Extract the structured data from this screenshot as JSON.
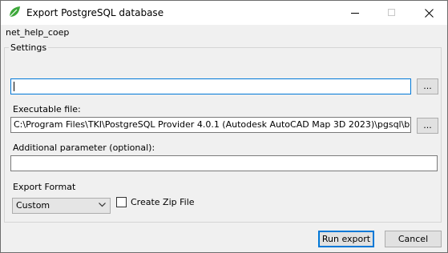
{
  "window": {
    "title": "Export PostgreSQL database",
    "icon": "leaf-icon"
  },
  "database_name": "net_help_coep",
  "settings": {
    "title": "Settings",
    "output_file": {
      "value": "",
      "browse_label": "..."
    },
    "executable": {
      "label": "Executable file:",
      "value": "C:\\Program Files\\TKI\\PostgreSQL Provider 4.0.1 (Autodesk AutoCAD Map 3D 2023)\\pgsql\\bin\\pg_dump",
      "browse_label": "..."
    },
    "additional": {
      "label": "Additional parameter (optional):",
      "value": ""
    },
    "export_format": {
      "label": "Export Format",
      "selected": "Custom"
    },
    "zip": {
      "label": "Create Zip File",
      "checked": false
    }
  },
  "buttons": {
    "run": "Run export",
    "cancel": "Cancel"
  },
  "colors": {
    "accent": "#0078d7",
    "leaf": "#3da83a"
  }
}
